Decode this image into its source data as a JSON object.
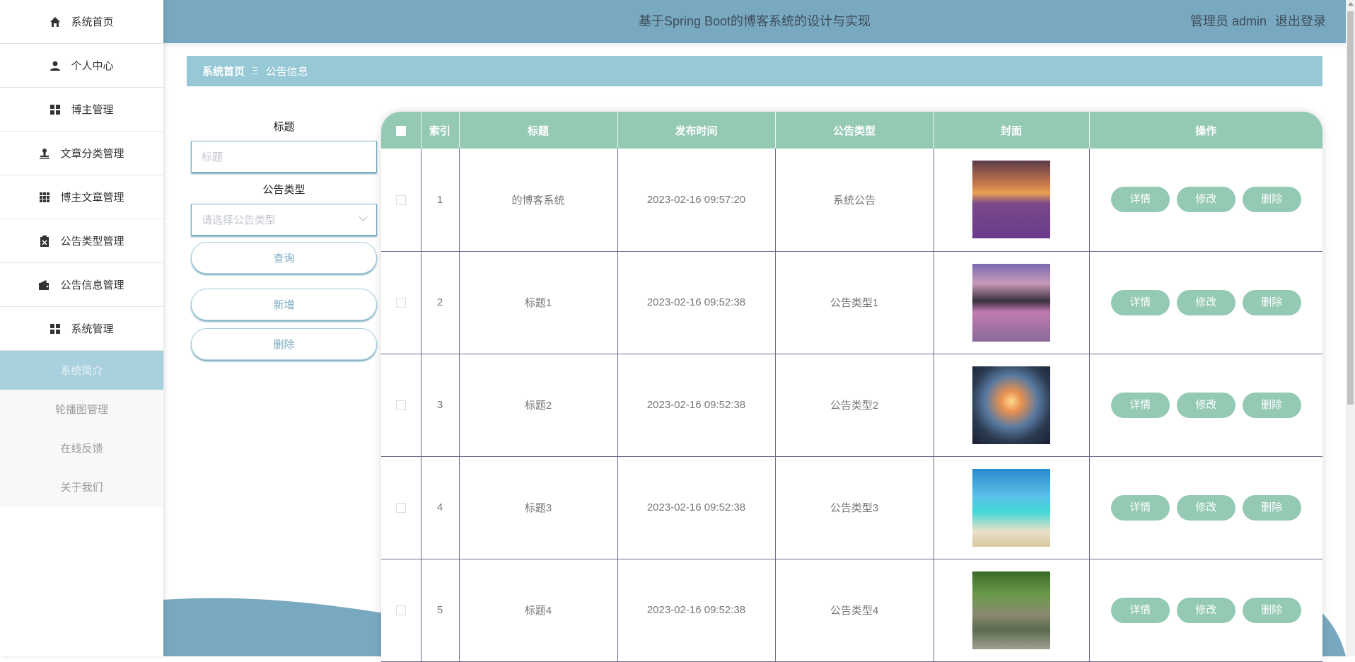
{
  "header": {
    "title": "基于Spring Boot的博客系统的设计与实现",
    "user": "管理员 admin",
    "logout": "退出登录"
  },
  "sidebar": {
    "items": [
      {
        "label": "系统首页",
        "icon": "home-icon"
      },
      {
        "label": "个人中心",
        "icon": "user-icon"
      },
      {
        "label": "博主管理",
        "icon": "grid-icon"
      },
      {
        "label": "文章分类管理",
        "icon": "stamp-icon"
      },
      {
        "label": "博主文章管理",
        "icon": "apps-icon"
      },
      {
        "label": "公告类型管理",
        "icon": "clipboard-icon"
      },
      {
        "label": "公告信息管理",
        "icon": "wallet-icon"
      },
      {
        "label": "系统管理",
        "icon": "grid-icon"
      }
    ],
    "subitems": [
      {
        "label": "系统简介",
        "active": true
      },
      {
        "label": "轮播图管理"
      },
      {
        "label": "在线反馈"
      },
      {
        "label": "关于我们"
      }
    ]
  },
  "breadcrumb": {
    "home": "系统首页",
    "separator": "Ξ",
    "current": "公告信息"
  },
  "search": {
    "title_label": "标题",
    "title_placeholder": "标题",
    "type_label": "公告类型",
    "type_placeholder": "请选择公告类型",
    "query": "查询",
    "add": "新增",
    "delete": "删除"
  },
  "table": {
    "columns": [
      "索引",
      "标题",
      "发布时间",
      "公告类型",
      "封面",
      "操作"
    ],
    "actions": {
      "detail": "详情",
      "edit": "修改",
      "delete": "删除"
    },
    "rows": [
      {
        "index": "1",
        "title": "的博客系统",
        "time": "2023-02-16 09:57:20",
        "type": "系统公告"
      },
      {
        "index": "2",
        "title": "标题1",
        "time": "2023-02-16 09:52:38",
        "type": "公告类型1"
      },
      {
        "index": "3",
        "title": "标题2",
        "time": "2023-02-16 09:52:38",
        "type": "公告类型2"
      },
      {
        "index": "4",
        "title": "标题3",
        "time": "2023-02-16 09:52:38",
        "type": "公告类型3"
      },
      {
        "index": "5",
        "title": "标题4",
        "time": "2023-02-16 09:52:38",
        "type": "公告类型4"
      }
    ]
  },
  "colors": {
    "header": "#79a9c0",
    "breadcrumb": "#97c8d5",
    "table_header": "#94c9b4",
    "active_sub": "#a9d0dd"
  }
}
